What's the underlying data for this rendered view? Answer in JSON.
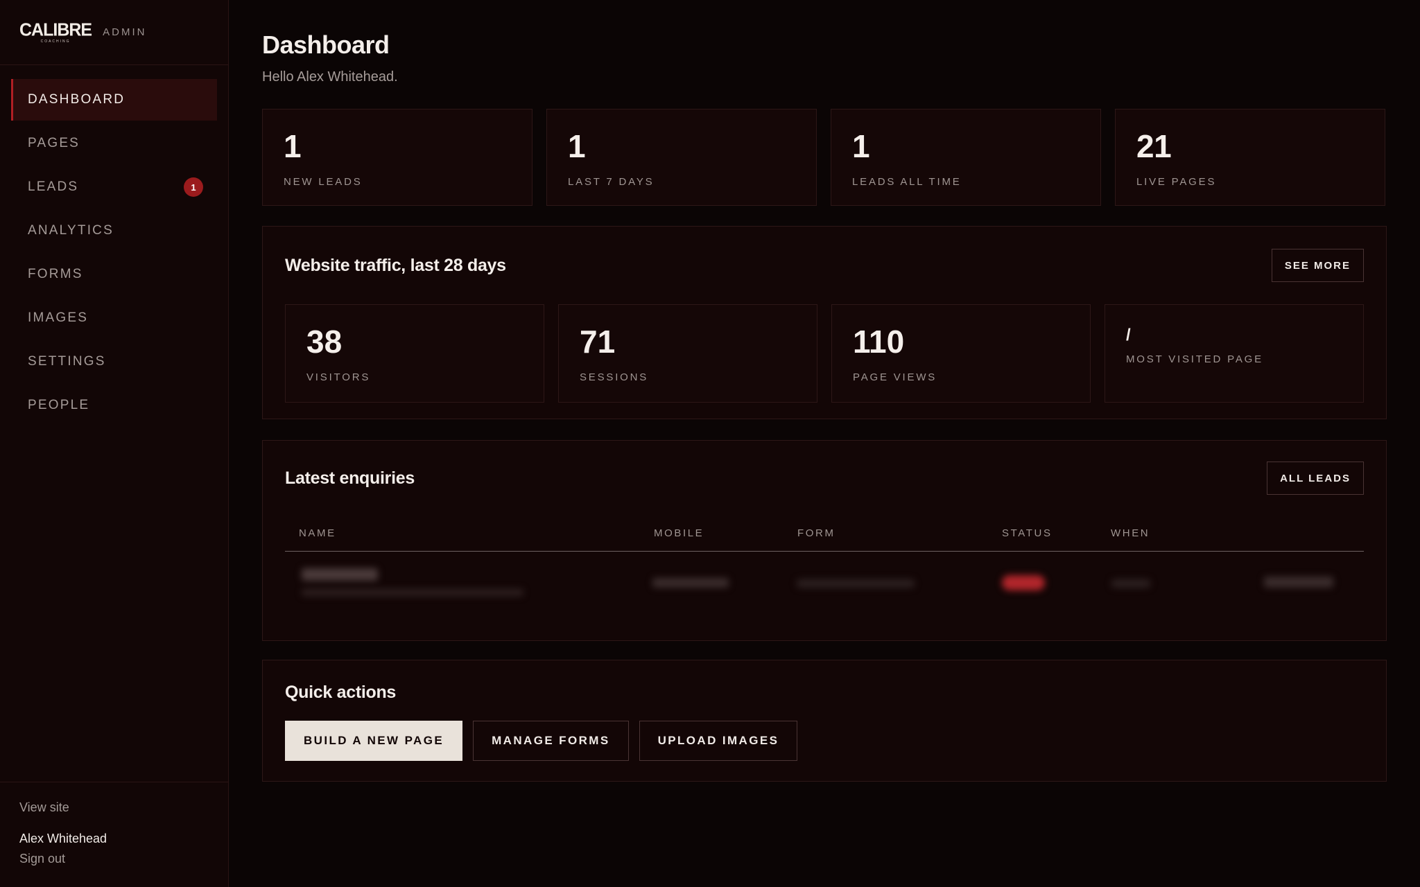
{
  "brand": {
    "logo_text": "CALIBRE",
    "logo_sub": "COACHING",
    "tag": "ADMIN"
  },
  "sidebar": {
    "items": [
      {
        "label": "DASHBOARD",
        "active": true
      },
      {
        "label": "PAGES"
      },
      {
        "label": "LEADS",
        "badge": "1"
      },
      {
        "label": "ANALYTICS"
      },
      {
        "label": "FORMS"
      },
      {
        "label": "IMAGES"
      },
      {
        "label": "SETTINGS"
      },
      {
        "label": "PEOPLE"
      }
    ],
    "view_site": "View site",
    "user_name": "Alex Whitehead",
    "sign_out": "Sign out"
  },
  "header": {
    "title": "Dashboard",
    "greeting": "Hello Alex Whitehead."
  },
  "stats": [
    {
      "value": "1",
      "label": "NEW LEADS"
    },
    {
      "value": "1",
      "label": "LAST 7 DAYS"
    },
    {
      "value": "1",
      "label": "LEADS ALL TIME"
    },
    {
      "value": "21",
      "label": "LIVE PAGES"
    }
  ],
  "traffic": {
    "title": "Website traffic, last 28 days",
    "see_more": "SEE MORE",
    "cards": [
      {
        "value": "38",
        "label": "VISITORS"
      },
      {
        "value": "71",
        "label": "SESSIONS"
      },
      {
        "value": "110",
        "label": "PAGE VIEWS"
      },
      {
        "value": "/",
        "label": "MOST VISITED PAGE"
      }
    ]
  },
  "enquiries": {
    "title": "Latest enquiries",
    "all_leads": "ALL LEADS",
    "columns": [
      "NAME",
      "MOBILE",
      "FORM",
      "STATUS",
      "WHEN"
    ]
  },
  "quick_actions": {
    "title": "Quick actions",
    "buttons": [
      "BUILD A NEW PAGE",
      "MANAGE FORMS",
      "UPLOAD IMAGES"
    ]
  },
  "colors": {
    "accent": "#b11f24",
    "badge": "#9b1b1d",
    "background": "#0b0505",
    "panel": "#130606",
    "primary_button": "#e9e2da"
  }
}
